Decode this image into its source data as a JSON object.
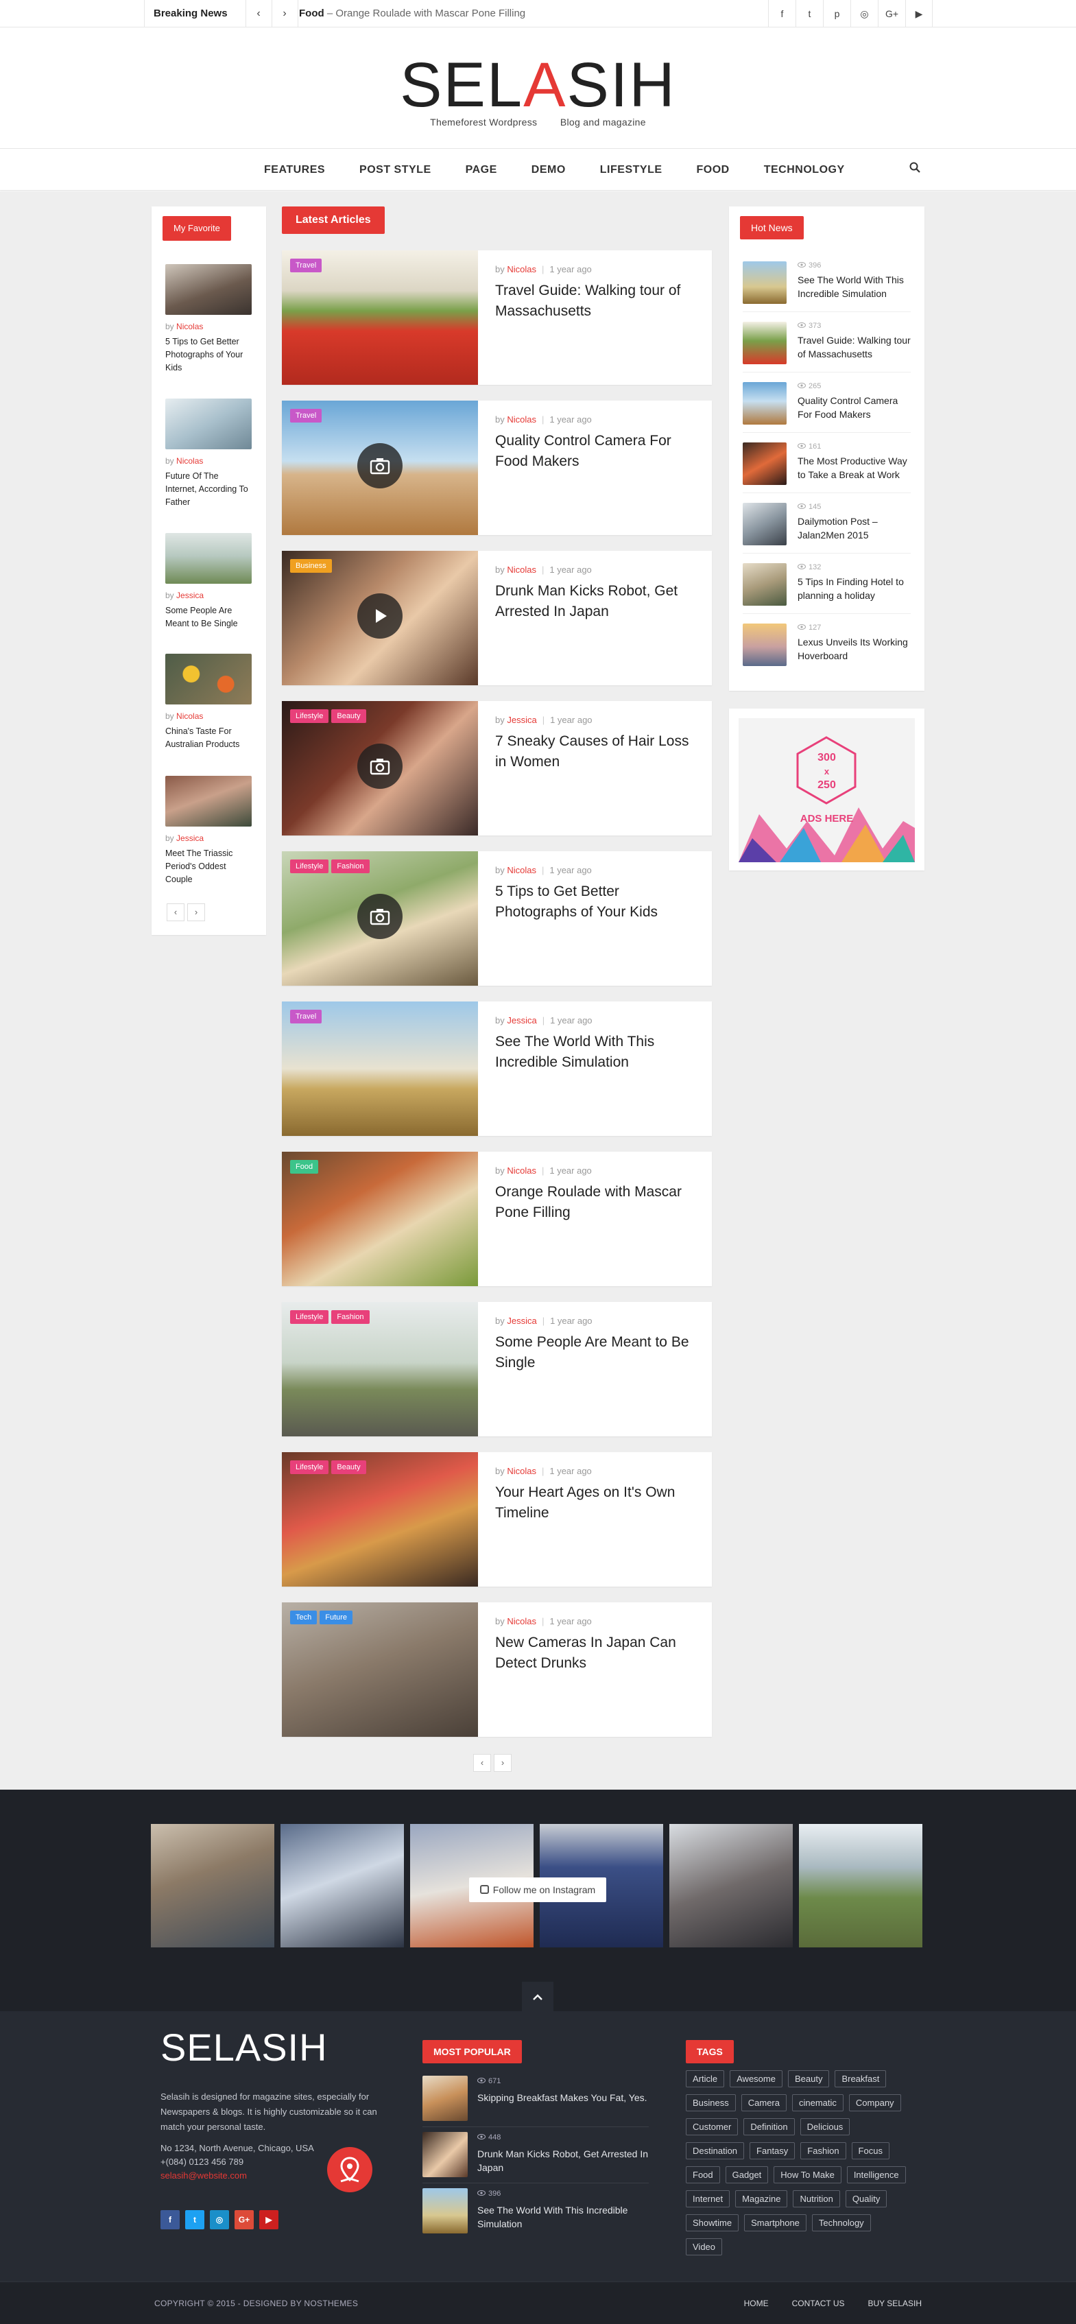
{
  "topbar": {
    "breaking_label": "Breaking News",
    "prev_arrow": "‹",
    "next_arrow": "›",
    "news_category": "Food",
    "news_sep": " – ",
    "news_text": "Orange Roulade with Mascar Pone Filling",
    "social": [
      "f",
      "t",
      "p",
      "◎",
      "G+",
      "▶"
    ]
  },
  "header": {
    "logo_left": "SEL",
    "logo_mid": "A",
    "logo_right": "SIH",
    "tagline": "Themeforest Wordpress        Blog and magazine"
  },
  "nav": {
    "items": [
      "FEATURES",
      "POST STYLE",
      "PAGE",
      "DEMO",
      "LIFESTYLE",
      "FOOD",
      "TECHNOLOGY"
    ],
    "search_icon": "search-icon"
  },
  "favorites": {
    "heading": "My Favorite",
    "by": "by",
    "items": [
      {
        "author": "Nicolas",
        "title": "5 Tips to Get Better Photographs of Your Kids"
      },
      {
        "author": "Nicolas",
        "title": "Future Of The Internet, According To Father"
      },
      {
        "author": "Jessica",
        "title": "Some People Are Meant to Be Single"
      },
      {
        "author": "Nicolas",
        "title": "China's Taste For Australian Products"
      },
      {
        "author": "Jessica",
        "title": "Meet The Triassic Period's Oddest Couple"
      }
    ],
    "prev": "‹",
    "next": "›"
  },
  "latest": {
    "heading": "Latest Articles",
    "by": "by",
    "sep": "|",
    "items": [
      {
        "tags": [
          "Travel"
        ],
        "author": "Nicolas",
        "time": "1 year ago",
        "title": "Travel Guide: Walking tour of Massachusetts"
      },
      {
        "tags": [
          "Travel"
        ],
        "author": "Nicolas",
        "time": "1 year ago",
        "title": "Quality Control Camera For Food Makers"
      },
      {
        "tags": [
          "Business"
        ],
        "author": "Nicolas",
        "time": "1 year ago",
        "title": "Drunk Man Kicks Robot, Get Arrested In Japan"
      },
      {
        "tags": [
          "Lifestyle",
          "Beauty"
        ],
        "author": "Jessica",
        "time": "1 year ago",
        "title": "7 Sneaky Causes of Hair Loss in Women"
      },
      {
        "tags": [
          "Lifestyle",
          "Fashion"
        ],
        "author": "Nicolas",
        "time": "1 year ago",
        "title": "5 Tips to Get Better Photographs of Your Kids"
      },
      {
        "tags": [
          "Travel"
        ],
        "author": "Jessica",
        "time": "1 year ago",
        "title": "See The World With This Incredible Simulation"
      },
      {
        "tags": [
          "Food"
        ],
        "author": "Nicolas",
        "time": "1 year ago",
        "title": "Orange Roulade with Mascar Pone Filling"
      },
      {
        "tags": [
          "Lifestyle",
          "Fashion"
        ],
        "author": "Jessica",
        "time": "1 year ago",
        "title": "Some People Are Meant to Be Single"
      },
      {
        "tags": [
          "Lifestyle",
          "Beauty"
        ],
        "author": "Nicolas",
        "time": "1 year ago",
        "title": "Your Heart Ages on It's Own Timeline"
      },
      {
        "tags": [
          "Tech",
          "Future"
        ],
        "author": "Nicolas",
        "time": "1 year ago",
        "title": "New Cameras In Japan Can Detect Drunks"
      }
    ],
    "tag_colors": {
      "Travel": "#c858c8",
      "Business": "#f0a020",
      "Lifestyle": "#e8407a",
      "Beauty": "#e8407a",
      "Fashion": "#e8407a",
      "Food": "#3cc48a",
      "Tech": "#3a8ee6",
      "Future": "#3a8ee6"
    },
    "prev": "‹",
    "next": "›"
  },
  "hot": {
    "heading": "Hot News",
    "items": [
      {
        "views": "396",
        "title": "See The World With This Incredible Simulation"
      },
      {
        "views": "373",
        "title": "Travel Guide: Walking tour of Massachusetts"
      },
      {
        "views": "265",
        "title": "Quality Control Camera For Food Makers"
      },
      {
        "views": "161",
        "title": "The Most Productive Way to Take a Break at Work"
      },
      {
        "views": "145",
        "title": "Dailymotion Post – Jalan2Men 2015"
      },
      {
        "views": "132",
        "title": "5 Tips In Finding Hotel to planning a holiday"
      },
      {
        "views": "127",
        "title": "Lexus Unveils Its Working Hoverboard"
      }
    ]
  },
  "ads": {
    "line1": "300",
    "line2": "x",
    "line3": "250",
    "label": "ADS HERE"
  },
  "instagram": {
    "follow": "Follow me on Instagram"
  },
  "footer": {
    "logo": "SELASIH",
    "desc": "Selasih is designed for magazine sites, especially for Newspapers & blogs. It is highly customizable so it can match your personal taste.",
    "address": "No 1234, North Avenue, Chicago, USA",
    "phone": "+(084) 0123 456 789",
    "email": "selasih@website.com",
    "social": [
      "f",
      "t",
      "◎",
      "G+",
      "▶"
    ],
    "popular_heading": "MOST POPULAR",
    "popular": [
      {
        "views": "671",
        "title": "Skipping Breakfast Makes You Fat, Yes."
      },
      {
        "views": "448",
        "title": "Drunk Man Kicks Robot, Get Arrested In Japan"
      },
      {
        "views": "396",
        "title": "See The World With This Incredible Simulation"
      }
    ],
    "tags_heading": "TAGS",
    "tags": [
      "Article",
      "Awesome",
      "Beauty",
      "Breakfast",
      "Business",
      "Camera",
      "cinematic",
      "Company",
      "Customer",
      "Definition",
      "Delicious",
      "Destination",
      "Fantasy",
      "Fashion",
      "Focus",
      "Food",
      "Gadget",
      "How To Make",
      "Intelligence",
      "Internet",
      "Magazine",
      "Nutrition",
      "Quality",
      "Showtime",
      "Smartphone",
      "Technology",
      "Video"
    ]
  },
  "copyright": {
    "text": "COPYRIGHT © 2015 - DESIGNED BY NOSTHEMES",
    "links": [
      "HOME",
      "CONTACT US",
      "BUY SELASIH"
    ]
  },
  "colors": {
    "accent": "#e53935",
    "footer_bg": "#272b33",
    "main_bg": "#eeeeee"
  }
}
